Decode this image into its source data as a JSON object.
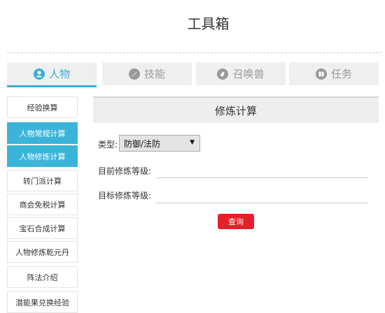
{
  "page": {
    "title": "工具箱"
  },
  "tabs": [
    {
      "label": "人物",
      "icon": "person-icon",
      "active": true
    },
    {
      "label": "技能",
      "icon": "skill-icon",
      "active": false
    },
    {
      "label": "召唤兽",
      "icon": "summon-icon",
      "active": false
    },
    {
      "label": "任务",
      "icon": "quest-icon",
      "active": false
    }
  ],
  "sidebar": {
    "items": [
      {
        "label": "经验换算",
        "selected": false
      },
      {
        "label": "人物常规计算",
        "selected": true
      },
      {
        "label": "人物修炼计算",
        "selected": true
      },
      {
        "label": "转门派计算",
        "selected": false
      },
      {
        "label": "商会免税计算",
        "selected": false
      },
      {
        "label": "宝石合成计算",
        "selected": false
      },
      {
        "label": "人物修炼乾元丹",
        "selected": false
      },
      {
        "label": "阵法介绍",
        "selected": false
      },
      {
        "label": "潜能果兑换经验",
        "selected": false
      }
    ]
  },
  "panel": {
    "title": "修炼计算",
    "type_label": "类型:",
    "type_value": "防御/法防",
    "current_label": "目前修炼等级:",
    "current_value": "",
    "target_label": "目标修炼等级:",
    "target_value": "",
    "query_label": "查询"
  },
  "colors": {
    "accent": "#3bb4d9",
    "button": "#e5202a",
    "tab_bg": "#efefef"
  }
}
